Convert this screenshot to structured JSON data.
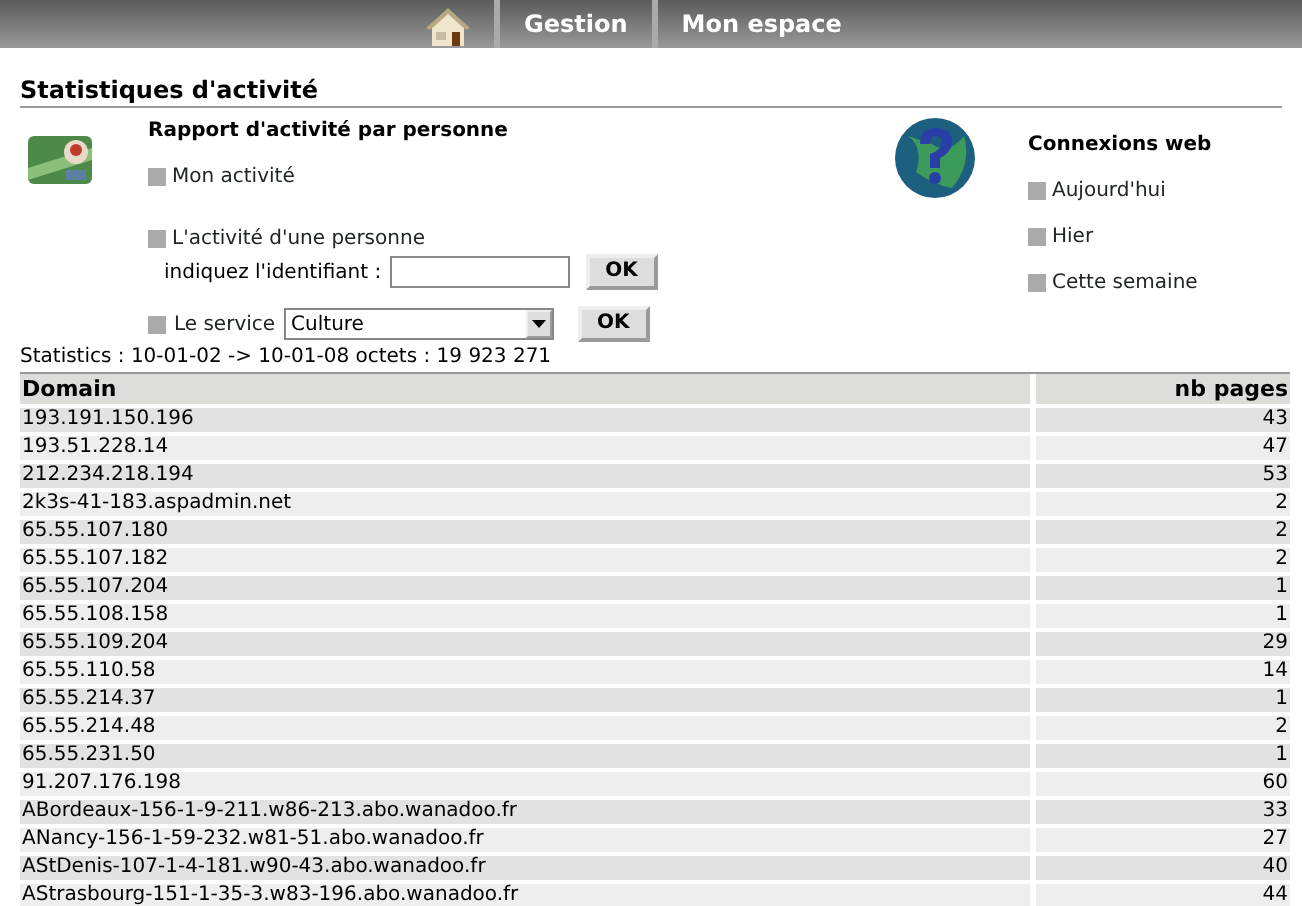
{
  "nav": {
    "items": [
      {
        "kind": "home"
      },
      {
        "kind": "text",
        "label": "Gestion"
      },
      {
        "kind": "text",
        "label": "Mon espace"
      }
    ]
  },
  "page_title": "Statistiques d'activité",
  "report": {
    "title": "Rapport d'activité par personne",
    "links": [
      "Mon activité",
      "L'activité d'une personne"
    ],
    "id_label": "indiquez l'identifiant :",
    "id_button": "OK",
    "service_label": "Le service",
    "service_value": "Culture",
    "service_button": "OK"
  },
  "web": {
    "title": "Connexions web",
    "links": [
      "Aujourd'hui",
      "Hier",
      "Cette semaine"
    ]
  },
  "summary": "Statistics : 10-01-02 -> 10-01-08 octets : 19 923 271",
  "table": {
    "columns": [
      "Domain",
      "nb pages"
    ],
    "rows": [
      [
        "193.191.150.196",
        "43"
      ],
      [
        "193.51.228.14",
        "47"
      ],
      [
        "212.234.218.194",
        "53"
      ],
      [
        "2k3s-41-183.aspadmin.net",
        "2"
      ],
      [
        "65.55.107.180",
        "2"
      ],
      [
        "65.55.107.182",
        "2"
      ],
      [
        "65.55.107.204",
        "1"
      ],
      [
        "65.55.108.158",
        "1"
      ],
      [
        "65.55.109.204",
        "29"
      ],
      [
        "65.55.110.58",
        "14"
      ],
      [
        "65.55.214.37",
        "1"
      ],
      [
        "65.55.214.48",
        "2"
      ],
      [
        "65.55.231.50",
        "1"
      ],
      [
        "91.207.176.198",
        "60"
      ],
      [
        "ABordeaux-156-1-9-211.w86-213.abo.wanadoo.fr",
        "33"
      ],
      [
        "ANancy-156-1-59-232.w81-51.abo.wanadoo.fr",
        "27"
      ],
      [
        "AStDenis-107-1-4-181.w90-43.abo.wanadoo.fr",
        "40"
      ],
      [
        "AStrasbourg-151-1-35-3.w83-196.abo.wanadoo.fr",
        "44"
      ]
    ]
  }
}
